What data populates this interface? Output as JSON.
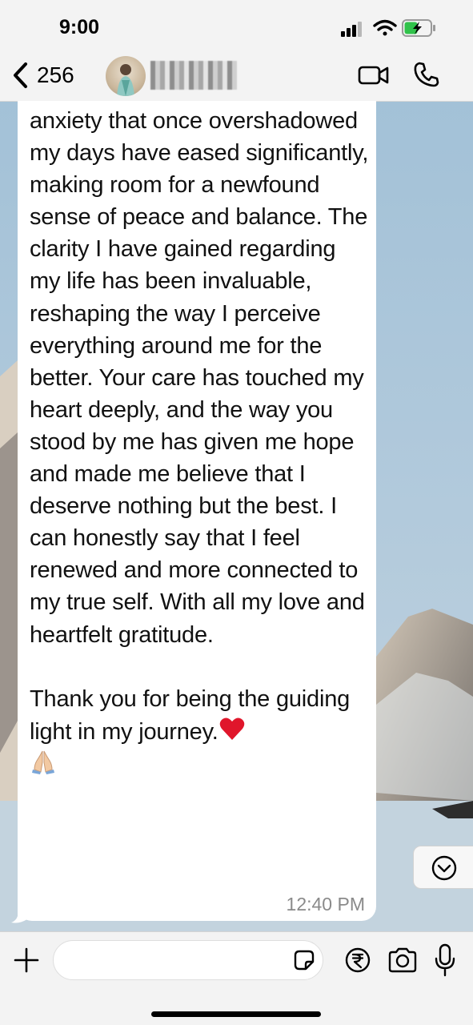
{
  "status_bar": {
    "time": "9:00"
  },
  "header": {
    "back_count": "256"
  },
  "message": {
    "text": "anxiety that once overshadowed my days have eased significantly, making room for a newfound sense of peace and balance. The clarity I have gained regarding my life has been invaluable, reshaping the way I perceive everything around me for the better. Your care has touched my heart deeply, and the way you stood by me has given me hope and made me believe that I deserve nothing but the best. I can honestly say that I feel renewed and more connected to my true self. With all my love and heartfelt gratitude.\n\nThank you for being the guiding light in my journey.",
    "emoji_heart": "red-heart",
    "emoji_hands": "folded-hands",
    "time": "12:40 PM"
  },
  "colors": {
    "top_bar": "#f3f3f3",
    "bubble": "#ffffff",
    "timestamp": "#8a8a8a",
    "heart": "#e0162b"
  },
  "icons": [
    "back-chevron-icon",
    "video-call-icon",
    "phone-icon",
    "chevron-down-icon",
    "plus-icon",
    "sticker-icon",
    "rupee-icon",
    "camera-icon",
    "microphone-icon"
  ]
}
